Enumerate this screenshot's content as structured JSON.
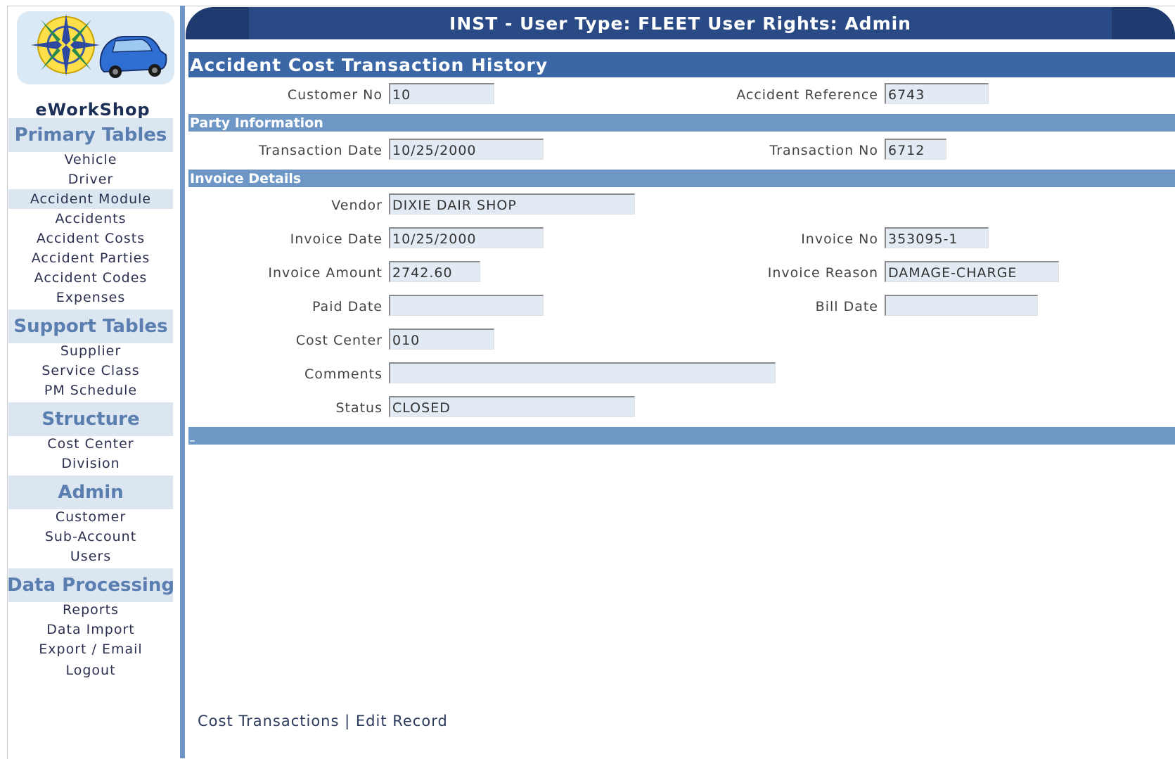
{
  "banner": {
    "title": "INST - User Type: FLEET User Rights: Admin"
  },
  "brand": "eWorkShop",
  "sidebar": {
    "primary": {
      "heading": "Primary Tables",
      "items": [
        "Vehicle",
        "Driver",
        "Accident Module",
        "Accidents",
        "Accident Costs",
        "Accident Parties",
        "Accident Codes",
        "Expenses"
      ]
    },
    "support": {
      "heading": "Support Tables",
      "items": [
        "Supplier",
        "Service Class",
        "PM Schedule"
      ]
    },
    "structure": {
      "heading": "Structure",
      "items": [
        "Cost Center",
        "Division"
      ]
    },
    "admin": {
      "heading": "Admin",
      "items": [
        "Customer",
        "Sub-Account",
        "Users"
      ]
    },
    "data": {
      "heading": "Data Processing",
      "items": [
        "Reports",
        "Data Import",
        "Export / Email",
        "Logout"
      ]
    }
  },
  "page": {
    "title": "Accident Cost Transaction History",
    "customer_no_label": "Customer No",
    "customer_no": "10",
    "accident_ref_label": "Accident Reference",
    "accident_ref": "6743"
  },
  "party": {
    "heading": "Party Information",
    "transaction_date_label": "Transaction Date",
    "transaction_date": "10/25/2000",
    "transaction_no_label": "Transaction No",
    "transaction_no": "6712"
  },
  "invoice": {
    "heading": "Invoice Details",
    "vendor_label": "Vendor",
    "vendor": "DIXIE DAIR SHOP",
    "invoice_date_label": "Invoice Date",
    "invoice_date": "10/25/2000",
    "invoice_no_label": "Invoice No",
    "invoice_no": "353095-1",
    "invoice_amount_label": "Invoice Amount",
    "invoice_amount": "2742.60",
    "invoice_reason_label": "Invoice Reason",
    "invoice_reason": "DAMAGE-CHARGE",
    "paid_date_label": "Paid Date",
    "paid_date": "",
    "bill_date_label": "Bill Date",
    "bill_date": "",
    "cost_center_label": "Cost Center",
    "cost_center": "010",
    "comments_label": "Comments",
    "comments": "",
    "status_label": "Status",
    "status": "CLOSED"
  },
  "bottom_bar": {
    "text": "_"
  },
  "footer": {
    "link1": "Cost Transactions",
    "separator": "|",
    "link2": "Edit Record"
  }
}
